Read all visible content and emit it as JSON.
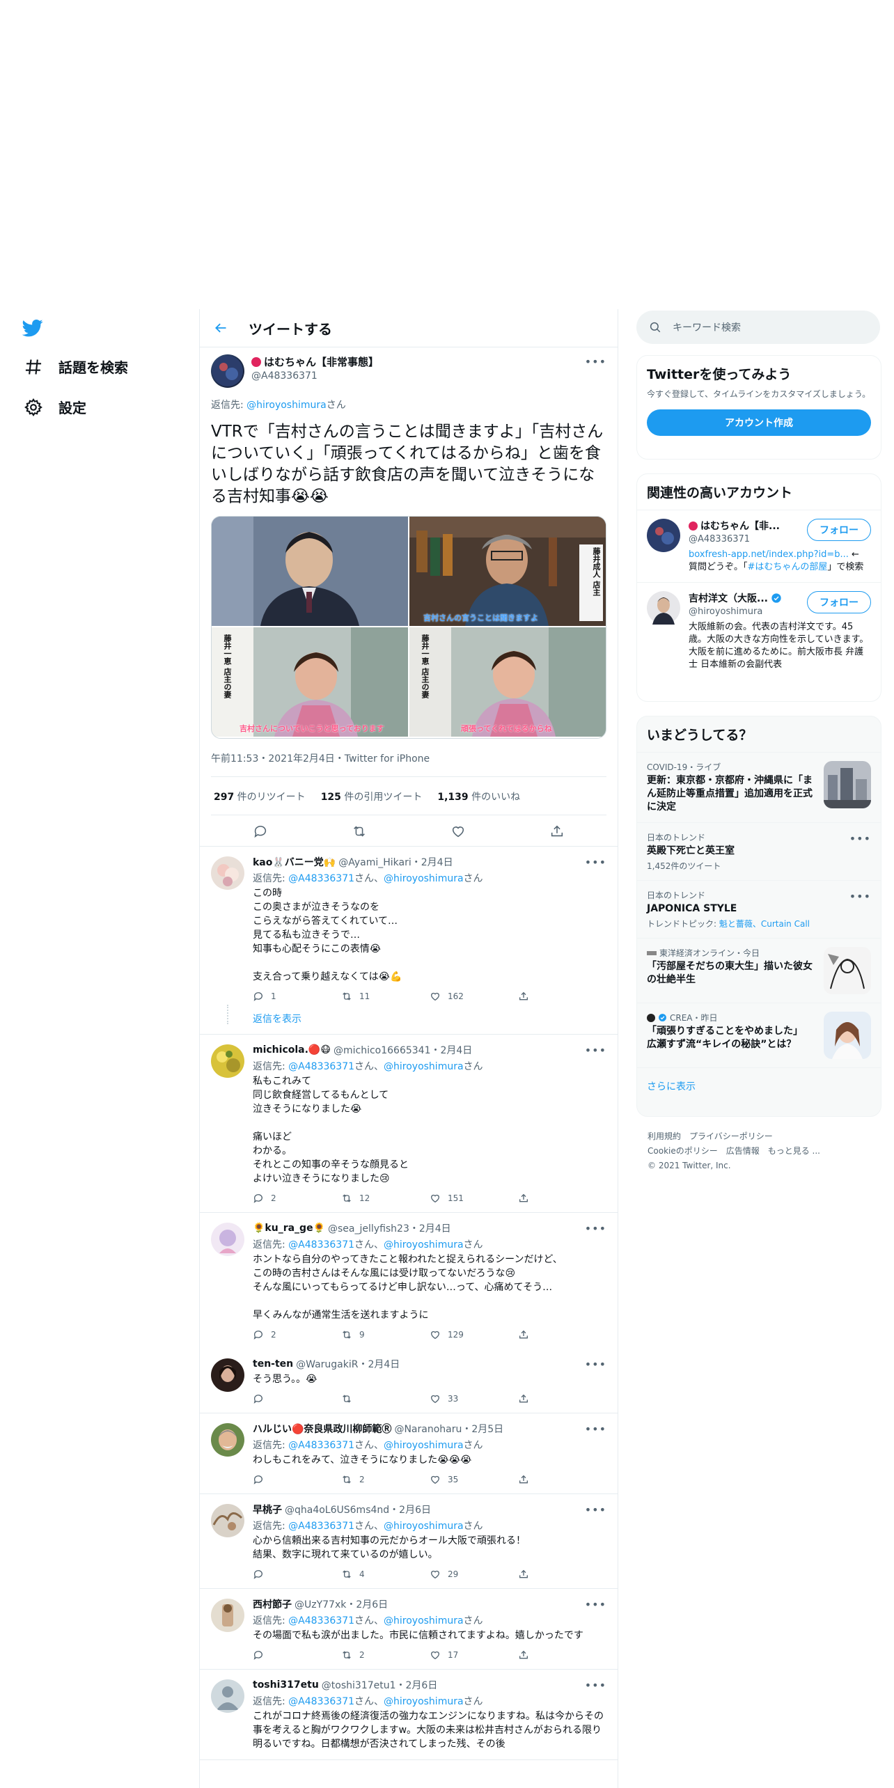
{
  "nav": {
    "explore_label": "話題を検索",
    "settings_label": "設定"
  },
  "topbar": {
    "title": "ツイートする"
  },
  "main_tweet": {
    "name": "はむちゃん【非常事態】",
    "handle": "@A48336371",
    "reply_prefix": "返信先: ",
    "reply_handle": "@hiroyoshimura",
    "reply_suffix": "さん",
    "text": "VTRで「吉村さんの言うことは聞きますよ」「吉村さんについていく」「頑張ってくれてはるからね」と歯を食いしばりながら話す飲食店の声を聞いて泣きそうになる吉村知事😭😭",
    "meta": "午前11:53・2021年2月4日・Twitter for iPhone",
    "retweets_count": "297",
    "retweets_label": " 件のリツイート",
    "quotes_count": "125",
    "quotes_label": " 件の引用ツイート",
    "likes_count": "1,139",
    "likes_label": " 件のいいね",
    "media_captions": [
      "",
      "吉村さんの言うことは聞きますよ",
      "吉村さんについていこうと思っております",
      "頑張ってくれてはるからね"
    ],
    "media_name_tags": [
      "",
      "藤井成人 店主",
      "藤井一恵 店主の妻",
      "藤井一恵 店主の妻"
    ]
  },
  "replies": [
    {
      "name": "kao🐰バニー党🙌",
      "meta": "@Ayami_Hikari・2月4日",
      "reply_to_prefix": "返信先: ",
      "reply_to_1": "@A48336371",
      "reply_to_mid": "さん、",
      "reply_to_2": "@hiroyoshimura",
      "reply_to_suffix": "さん",
      "text": "この時\nこの奥さまが泣きそうなのを\nこらえながら答えてくれていて…\n見てる私も泣きそうで…\n知事も心配そうにこの表情😭\n\n支え合って乗り越えなくては😭💪",
      "replies": "1",
      "retweets": "11",
      "likes": "162",
      "show_replies": "返信を表示"
    },
    {
      "name": "michicola.🔴😷",
      "meta": "@michico16665341・2月4日",
      "reply_to_prefix": "返信先: ",
      "reply_to_1": "@A48336371",
      "reply_to_mid": "さん、",
      "reply_to_2": "@hiroyoshimura",
      "reply_to_suffix": "さん",
      "text": "私もこれみて\n同じ飲食経営してるもんとして\n泣きそうになりました😭\n\n痛いほど\nわかる。\nそれとこの知事の辛そうな顔見ると\nよけい泣きそうになりました😢",
      "replies": "2",
      "retweets": "12",
      "likes": "151"
    },
    {
      "name": "🌻ku_ra_ge🌻",
      "meta": "@sea_jellyfish23・2月4日",
      "reply_to_prefix": "返信先: ",
      "reply_to_1": "@A48336371",
      "reply_to_mid": "さん、",
      "reply_to_2": "@hiroyoshimura",
      "reply_to_suffix": "さん",
      "text": "ホントなら自分のやってきたこと報われたと捉えられるシーンだけど、\nこの時の吉村さんはそんな風には受け取ってないだろうな😢\nそんな風にいってもらってるけど申し訳ない…って、心痛めてそう…\n\n早くみんなが通常生活を送れますように",
      "replies": "2",
      "retweets": "9",
      "likes": "129"
    },
    {
      "name": "ten-ten",
      "meta": "@WarugakiR・2月4日",
      "text": "そう思う。。😭",
      "replies": "",
      "retweets": "",
      "likes": "33"
    },
    {
      "name": "ハルじい🔴奈良県政川柳師範Ⓡ",
      "meta": "@Naranoharu・2月5日",
      "reply_to_prefix": "返信先: ",
      "reply_to_1": "@A48336371",
      "reply_to_mid": "さん、",
      "reply_to_2": "@hiroyoshimura",
      "reply_to_suffix": "さん",
      "text": "わしもこれをみて、泣きそうになりました😭😭😭",
      "replies": "",
      "retweets": "2",
      "likes": "35"
    },
    {
      "name": "早桃子",
      "meta": "@qha4oL6US6ms4nd・2月6日",
      "reply_to_prefix": "返信先: ",
      "reply_to_1": "@A48336371",
      "reply_to_mid": "さん、",
      "reply_to_2": "@hiroyoshimura",
      "reply_to_suffix": "さん",
      "text": "心から信頼出来る吉村知事の元だからオール大阪で頑張れる！\n結果、数字に現れて来ているのが嬉しい。",
      "replies": "",
      "retweets": "4",
      "likes": "29"
    },
    {
      "name": "西村節子",
      "meta": "@UzY77xk・2月6日",
      "reply_to_prefix": "返信先: ",
      "reply_to_1": "@A48336371",
      "reply_to_mid": "さん、",
      "reply_to_2": "@hiroyoshimura",
      "reply_to_suffix": "さん",
      "text": "その場面で私も涙が出ました。市民に信頼されてますよね。嬉しかったです",
      "replies": "",
      "retweets": "2",
      "likes": "17"
    },
    {
      "name": "toshi317etu",
      "meta": "@toshi317etu1・2月6日",
      "reply_to_prefix": "返信先: ",
      "reply_to_1": "@A48336371",
      "reply_to_mid": "さん、",
      "reply_to_2": "@hiroyoshimura",
      "reply_to_suffix": "さん",
      "text": "これがコロナ終焉後の経済復活の強力なエンジンになりますね。私は今からその事を考えると胸がワクワクしますw。大阪の未来は松井吉村さんがおられる限り明るいですね。日都構想が否決されてしまった残、その後"
    }
  ],
  "search": {
    "placeholder": "キーワード検索"
  },
  "signup": {
    "title": "Twitterを使ってみよう",
    "desc": "今すぐ登録して、タイムラインをカスタマイズしましょう。",
    "button": "アカウント作成"
  },
  "related": {
    "title": "関連性の高いアカウント",
    "accounts": [
      {
        "name": "はむちゃん【非...",
        "handle": "@A48336371",
        "follow": "フォロー",
        "desc_link1": "boxfresh-app.net/index.php?id=b...",
        "desc_text1": " ← 質問どうぞ。「",
        "desc_link2": "#はむちゃんの部屋",
        "desc_text2": "」で検索"
      },
      {
        "name": "吉村洋文（大阪...",
        "handle": "@hiroyoshimura",
        "follow": "フォロー",
        "desc": "大阪維新の会。代表の吉村洋文です。45歳。大阪の大きな方向性を示していきます。大阪を前に進めるために。前大阪市長 弁護士 日本維新の会副代表"
      }
    ]
  },
  "trends": {
    "title": "いまどうしてる？",
    "items": [
      {
        "category": "COVID-19・ライブ",
        "title": "更新：東京都・京都府・沖縄県に「まん延防止等重点措置」追加適用を正式に決定"
      },
      {
        "category": "日本のトレンド",
        "title": "英殿下死亡と英王室",
        "sub": "1,452件のツイート"
      },
      {
        "category": "日本のトレンド",
        "title": "JAPONICA STYLE",
        "sub_prefix": "トレンドトピック: ",
        "sub_link": "魁と薔薇、Curtain Call"
      },
      {
        "category": "東洋経済オンライン・今日",
        "title": "「汚部屋そだちの東大生」描いた彼女の壮絶半生"
      },
      {
        "category": "CREA・昨日",
        "title": "「頑張りすぎることをやめました」 広瀬すず流“キレイの秘訣”とは？"
      }
    ],
    "show_more": "さらに表示"
  },
  "footer": {
    "line1": "利用規約　プライバシーポリシー",
    "line2": "Cookieのポリシー　広告情報　もっと見る ...",
    "line3": "© 2021 Twitter, Inc."
  },
  "colors": {
    "accent": "#1d9bf0",
    "text": "#0f1419",
    "muted": "#536471",
    "border": "#e6ecf0"
  }
}
